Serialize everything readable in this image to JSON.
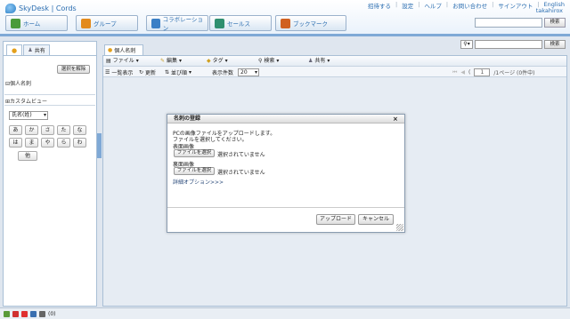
{
  "header": {
    "logo_text": "SkyDesk | Cords",
    "top_links": [
      "招待する",
      "設定",
      "ヘルプ",
      "お問い合わせ",
      "サインアウト",
      "English"
    ],
    "user_name": "takahirox",
    "search_button": "検索",
    "apps": [
      {
        "label": "ホーム",
        "icon": "home-icon",
        "color": "#4a9b3a"
      },
      {
        "label": "グループ",
        "icon": "group-icon",
        "color": "#e38a1c"
      },
      {
        "label": "コラボレーション",
        "icon": "collaboration-icon",
        "color": "#3a7fc6"
      },
      {
        "label": "セールス",
        "icon": "sales-icon",
        "color": "#2f8f6f"
      },
      {
        "label": "ブックマーク",
        "icon": "bookmark-icon",
        "color": "#d06020"
      }
    ]
  },
  "left_panel": {
    "tabs": [
      "",
      "共有"
    ],
    "clear_button": "選択を解除",
    "tree_personal": "個人名刺",
    "tree_custom": "カスタムビュー",
    "sort_select": "氏名(姓)",
    "kana_buttons": [
      "あ",
      "か",
      "さ",
      "た",
      "な",
      "は",
      "ま",
      "や",
      "ら",
      "わ",
      "他"
    ]
  },
  "main": {
    "tab_label": "個人名刺",
    "menus": [
      "ファイル",
      "編集",
      "タグ",
      "検索",
      "共有"
    ],
    "toolbar": {
      "list_view": "一覧表示",
      "refresh": "更新",
      "sort": "並び順",
      "count_label": "表示件数",
      "count_value": "20"
    },
    "pager": {
      "page_value": "1",
      "page_text": "/1ページ (0件中)"
    },
    "filter_button": "検索"
  },
  "dialog": {
    "title": "名刺の登録",
    "close": "×",
    "line1": "PCの画像ファイルをアップロードします。",
    "line2": "ファイルを選択してください。",
    "front_label": "表面画像",
    "back_label": "裏面画像",
    "file_button": "ファイルを選択",
    "no_file": "選択されていません",
    "advanced": "詳細オプション>>>",
    "upload_button": "アップロード",
    "cancel_button": "キャンセル"
  },
  "status_bar": {
    "count": "(0)"
  }
}
